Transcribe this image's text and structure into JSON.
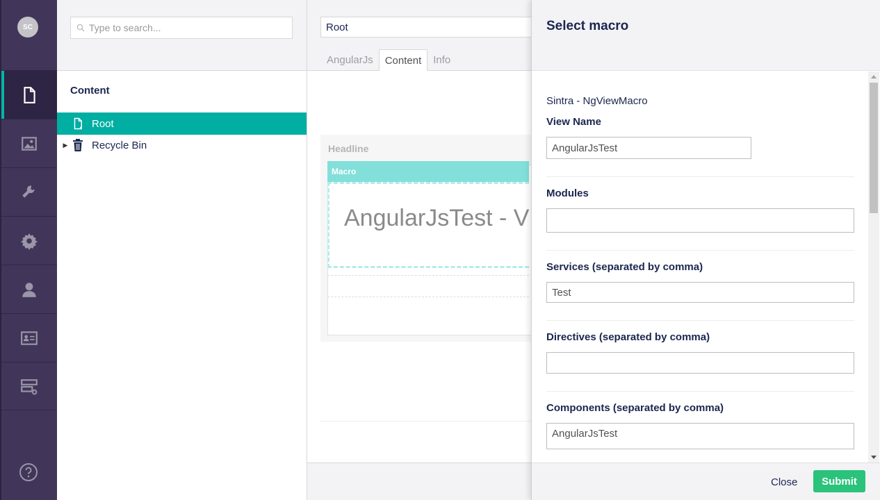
{
  "user": {
    "initials": "SC"
  },
  "sections": [
    {
      "name": "Content",
      "icon": "document-icon",
      "active": true
    },
    {
      "name": "Media",
      "icon": "image-icon",
      "active": false
    },
    {
      "name": "Settings",
      "icon": "wrench-icon",
      "active": false
    },
    {
      "name": "Packages",
      "icon": "gear-icon",
      "active": false
    },
    {
      "name": "Users",
      "icon": "user-icon",
      "active": false
    },
    {
      "name": "Members",
      "icon": "id-card-icon",
      "active": false
    },
    {
      "name": "Forms",
      "icon": "forms-icon",
      "active": false
    }
  ],
  "tree": {
    "search_placeholder": "Type to search...",
    "title": "Content",
    "nodes": [
      {
        "label": "Root",
        "icon": "document-icon",
        "selected": true
      },
      {
        "label": "Recycle Bin",
        "icon": "trash-icon",
        "selected": false
      }
    ]
  },
  "editor": {
    "node_name": "Root",
    "tabs": [
      {
        "label": "AngularJs",
        "active": false
      },
      {
        "label": "Content",
        "active": true
      },
      {
        "label": "Info",
        "active": false
      }
    ],
    "property_label": "Headline",
    "macro_label": "Macro",
    "macro_preview": "AngularJsTest - Vi"
  },
  "overlay": {
    "title": "Select macro",
    "macro_name": "Sintra - NgViewMacro",
    "fields": {
      "view_name": {
        "label": "View Name",
        "value": "AngularJsTest"
      },
      "modules": {
        "label": "Modules",
        "value": ""
      },
      "services": {
        "label": "Services (separated by comma)",
        "value": "Test"
      },
      "directives": {
        "label": "Directives (separated by comma)",
        "value": ""
      },
      "components": {
        "label": "Components (separated by comma)",
        "value": "AngularJsTest"
      }
    },
    "close_label": "Close",
    "submit_label": "Submit"
  },
  "colors": {
    "appbar": "#413659",
    "accent_teal": "#00aea2",
    "submit_green": "#2bc37c",
    "macro_teal_light": "#83dfda"
  }
}
